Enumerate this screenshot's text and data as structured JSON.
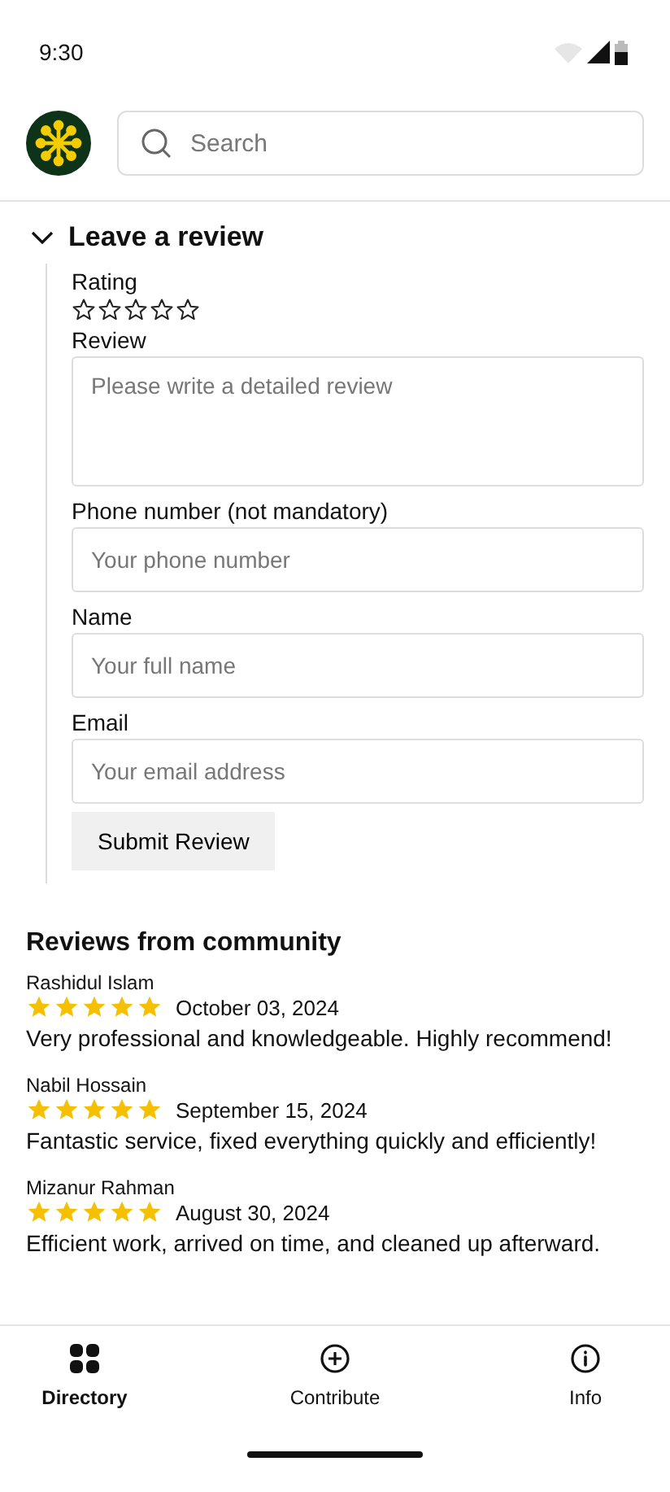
{
  "status_bar": {
    "time": "9:30"
  },
  "search": {
    "placeholder": "Search"
  },
  "review_form": {
    "title": "Leave a review",
    "expanded": true,
    "rating": {
      "label": "Rating",
      "stars": 0
    },
    "fields": [
      {
        "kind": "textarea",
        "label": "Review",
        "placeholder": "Please write a detailed review"
      },
      {
        "kind": "input",
        "label": "Phone number (not mandatory)",
        "placeholder": "Your phone number"
      },
      {
        "kind": "input",
        "label": "Name",
        "placeholder": "Your full name"
      },
      {
        "kind": "input",
        "label": "Email",
        "placeholder": "Your email address"
      }
    ],
    "submit": "Submit Review"
  },
  "reviews": {
    "title": "Reviews from community",
    "items": [
      {
        "author": "Rashidul Islam",
        "stars": 5,
        "date": "October 03, 2024",
        "text": "Very professional and knowledgeable. Highly recommend!"
      },
      {
        "author": "Nabil Hossain",
        "stars": 5,
        "date": "September 15, 2024",
        "text": "Fantastic service, fixed everything quickly and efficiently!"
      },
      {
        "author": "Mizanur Rahman",
        "stars": 5,
        "date": "August 30, 2024",
        "text": "Efficient work, arrived on time, and cleaned up afterward."
      }
    ]
  },
  "nav": [
    {
      "kind": "grid",
      "label": "Directory",
      "selected": true
    },
    {
      "kind": "plus",
      "label": "Contribute",
      "selected": false
    },
    {
      "kind": "info",
      "label": "Info",
      "selected": false
    }
  ]
}
